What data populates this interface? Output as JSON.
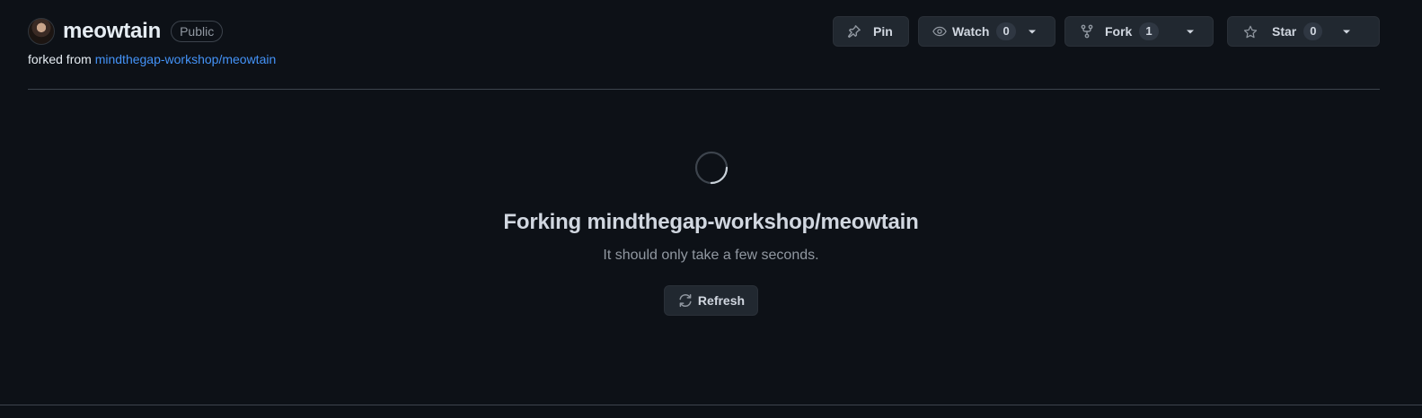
{
  "repo": {
    "name": "meowtain",
    "visibility": "Public",
    "forked_from_prefix": "forked from",
    "forked_from_link": "mindthegap-workshop/meowtain"
  },
  "actions": {
    "pin_label": "Pin",
    "watch_label": "Watch",
    "watch_count": "0",
    "fork_label": "Fork",
    "fork_count": "1",
    "star_label": "Star",
    "star_count": "0"
  },
  "status": {
    "title": "Forking mindthegap-workshop/meowtain",
    "subtitle": "It should only take a few seconds.",
    "refresh_label": "Refresh"
  },
  "icons": {
    "pin": "pin-icon",
    "watch": "eye-icon",
    "fork": "repo-forked-icon",
    "star": "star-icon",
    "caret": "triangle-down-icon",
    "spinner": "loading-spinner-icon",
    "refresh": "sync-icon"
  },
  "colors": {
    "background": "#0d1117",
    "link": "#4493f8",
    "button_bg": "#212830",
    "muted_text": "#9198a1",
    "border": "#3d444d"
  }
}
